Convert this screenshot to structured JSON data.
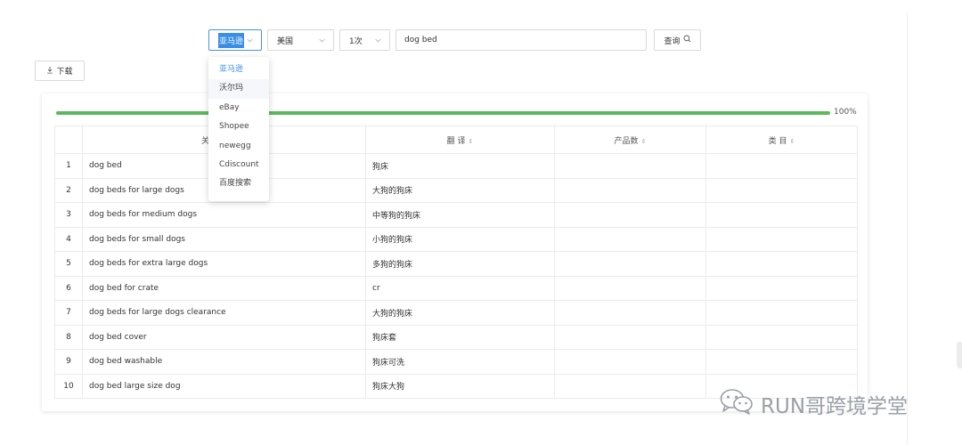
{
  "toolbar": {
    "platform_select": {
      "value": "亚马逊"
    },
    "country_select": {
      "value": "美国"
    },
    "count_select": {
      "value": "1次"
    },
    "keyword_input": {
      "value": "dog bed"
    },
    "query_label": "查询",
    "download_label": "下载"
  },
  "platform_dropdown": {
    "options": [
      "亚马逊",
      "沃尔玛",
      "eBay",
      "Shopee",
      "newegg",
      "Cdiscount",
      "百度搜索"
    ],
    "selected_index": 0,
    "hovered_index": 1
  },
  "progress": {
    "percent": 100,
    "label": "100%"
  },
  "table": {
    "columns": [
      "",
      "",
      "翻 译",
      "产品数",
      "类 目"
    ],
    "first_header_text": "关",
    "rows": [
      {
        "index": "1",
        "keyword": "dog bed",
        "translation": "狗床",
        "products": "",
        "category": ""
      },
      {
        "index": "2",
        "keyword": "dog beds for large dogs",
        "translation": "大狗的狗床",
        "products": "",
        "category": ""
      },
      {
        "index": "3",
        "keyword": "dog beds for medium dogs",
        "translation": "中等狗的狗床",
        "products": "",
        "category": ""
      },
      {
        "index": "4",
        "keyword": "dog beds for small dogs",
        "translation": "小狗的狗床",
        "products": "",
        "category": ""
      },
      {
        "index": "5",
        "keyword": "dog beds for extra large dogs",
        "translation": "多狗的狗床",
        "products": "",
        "category": ""
      },
      {
        "index": "6",
        "keyword": "dog bed for crate",
        "translation": "cr",
        "products": "",
        "category": ""
      },
      {
        "index": "7",
        "keyword": "dog beds for large dogs clearance",
        "translation": "大狗的狗床",
        "products": "",
        "category": ""
      },
      {
        "index": "8",
        "keyword": "dog bed cover",
        "translation": "狗床套",
        "products": "",
        "category": ""
      },
      {
        "index": "9",
        "keyword": "dog bed washable",
        "translation": "狗床可洗",
        "products": "",
        "category": ""
      },
      {
        "index": "10",
        "keyword": "dog bed large size dog",
        "translation": "狗床大狗",
        "products": "",
        "category": ""
      }
    ]
  },
  "watermark": {
    "text": "RUN哥跨境学堂"
  },
  "colors": {
    "accent": "#3a8ee6",
    "progress": "#5cb85c"
  }
}
